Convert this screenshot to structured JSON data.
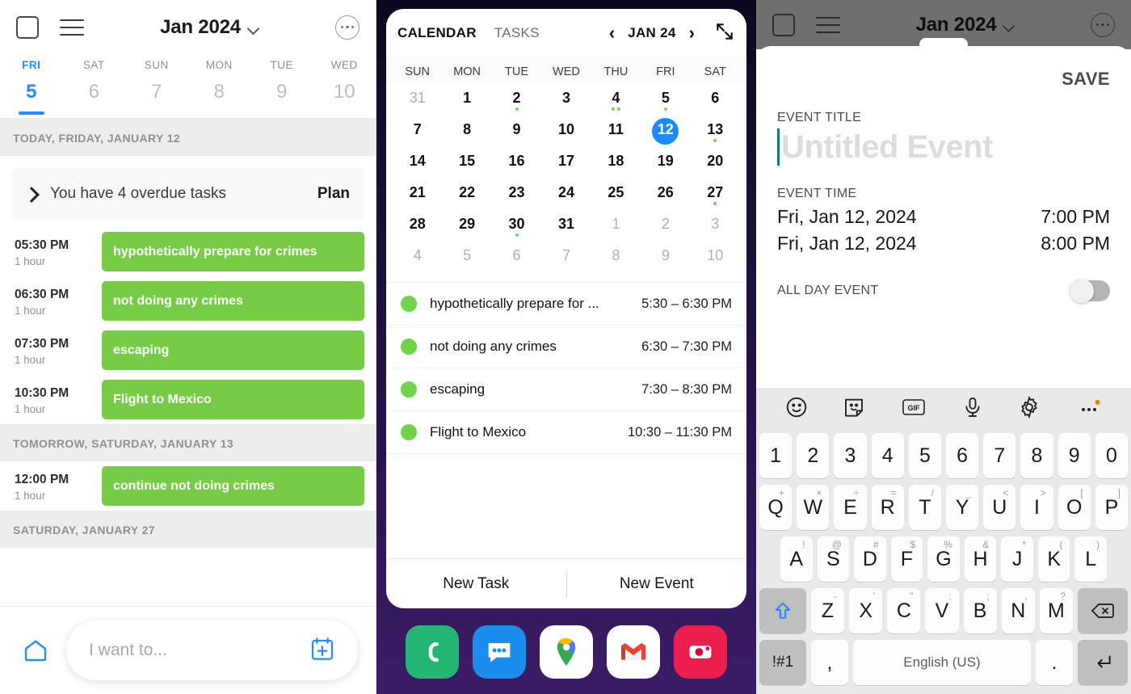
{
  "pane_tasks": {
    "topbar": {
      "checkbox_icon": "square-icon",
      "menu_icon": "hamburger-icon",
      "title": "Jan 2024",
      "chevron_icon": "chevron-down-icon",
      "more_icon": "more-options-icon"
    },
    "daystrip": [
      {
        "dow": "FRI",
        "num": "5",
        "active": true
      },
      {
        "dow": "SAT",
        "num": "6",
        "active": false
      },
      {
        "dow": "SUN",
        "num": "7",
        "active": false
      },
      {
        "dow": "MON",
        "num": "8",
        "active": false
      },
      {
        "dow": "TUE",
        "num": "9",
        "active": false
      },
      {
        "dow": "WED",
        "num": "10",
        "active": false
      }
    ],
    "section_today": "TODAY, FRIDAY, JANUARY 12",
    "overdue": {
      "expand_icon": "chevron-right-icon",
      "text": "You have 4 overdue tasks",
      "action": "Plan"
    },
    "today_tasks": [
      {
        "time": "05:30 PM",
        "dur": "1 hour",
        "title": "hypothetically prepare for crimes"
      },
      {
        "time": "06:30 PM",
        "dur": "1 hour",
        "title": "not doing any crimes"
      },
      {
        "time": "07:30 PM",
        "dur": "1 hour",
        "title": "escaping"
      },
      {
        "time": "10:30 PM",
        "dur": "1 hour",
        "title": "Flight to Mexico"
      }
    ],
    "section_tomorrow": "TOMORROW, SATURDAY, JANUARY 13",
    "tomorrow_tasks": [
      {
        "time": "12:00 PM",
        "dur": "1 hour",
        "title": "continue not doing crimes"
      }
    ],
    "section_sat27": "SATURDAY, JANUARY 27",
    "bottom": {
      "home_icon": "home-icon",
      "omni_placeholder": "I want to...",
      "add_event_icon": "calendar-plus-icon"
    },
    "colors": {
      "task_chip": "#76cc47",
      "accent": "#2c8aff",
      "section_bg": "#eceded"
    }
  },
  "pane_calendar": {
    "tabs": [
      {
        "label": "CALENDAR",
        "active": true
      },
      {
        "label": "TASKS",
        "active": false
      }
    ],
    "nav": {
      "prev_icon": "chevron-left-icon",
      "month": "JAN 24",
      "next_icon": "chevron-right-icon",
      "expand_icon": "expand-diagonal-icon"
    },
    "dow": [
      "SUN",
      "MON",
      "TUE",
      "WED",
      "THU",
      "FRI",
      "SAT"
    ],
    "weeks": [
      [
        {
          "n": "31",
          "muted": true,
          "dots": 0
        },
        {
          "n": "1",
          "muted": false,
          "dots": 0
        },
        {
          "n": "2",
          "muted": false,
          "dots": 1
        },
        {
          "n": "3",
          "muted": false,
          "dots": 0
        },
        {
          "n": "4",
          "muted": false,
          "dots": 2
        },
        {
          "n": "5",
          "muted": false,
          "dots": 1
        },
        {
          "n": "6",
          "muted": false,
          "dots": 0
        }
      ],
      [
        {
          "n": "7",
          "muted": false,
          "dots": 0
        },
        {
          "n": "8",
          "muted": false,
          "dots": 0
        },
        {
          "n": "9",
          "muted": false,
          "dots": 0
        },
        {
          "n": "10",
          "muted": false,
          "dots": 0
        },
        {
          "n": "11",
          "muted": false,
          "dots": 0
        },
        {
          "n": "12",
          "muted": false,
          "dots": 0,
          "selected": true
        },
        {
          "n": "13",
          "muted": false,
          "dots": 1
        }
      ],
      [
        {
          "n": "14",
          "muted": false,
          "dots": 0
        },
        {
          "n": "15",
          "muted": false,
          "dots": 0
        },
        {
          "n": "16",
          "muted": false,
          "dots": 0
        },
        {
          "n": "17",
          "muted": false,
          "dots": 0
        },
        {
          "n": "18",
          "muted": false,
          "dots": 0
        },
        {
          "n": "19",
          "muted": false,
          "dots": 0
        },
        {
          "n": "20",
          "muted": false,
          "dots": 0
        }
      ],
      [
        {
          "n": "21",
          "muted": false,
          "dots": 0
        },
        {
          "n": "22",
          "muted": false,
          "dots": 0
        },
        {
          "n": "23",
          "muted": false,
          "dots": 0
        },
        {
          "n": "24",
          "muted": false,
          "dots": 0
        },
        {
          "n": "25",
          "muted": false,
          "dots": 0
        },
        {
          "n": "26",
          "muted": false,
          "dots": 0
        },
        {
          "n": "27",
          "muted": false,
          "dots": 1
        }
      ],
      [
        {
          "n": "28",
          "muted": false,
          "dots": 0
        },
        {
          "n": "29",
          "muted": false,
          "dots": 0
        },
        {
          "n": "30",
          "muted": false,
          "dots": 1
        },
        {
          "n": "31",
          "muted": false,
          "dots": 0
        },
        {
          "n": "1",
          "muted": true,
          "dots": 0
        },
        {
          "n": "2",
          "muted": true,
          "dots": 0
        },
        {
          "n": "3",
          "muted": true,
          "dots": 0
        }
      ],
      [
        {
          "n": "4",
          "muted": true,
          "dots": 0
        },
        {
          "n": "5",
          "muted": true,
          "dots": 0
        },
        {
          "n": "6",
          "muted": true,
          "dots": 0
        },
        {
          "n": "7",
          "muted": true,
          "dots": 0
        },
        {
          "n": "8",
          "muted": true,
          "dots": 0
        },
        {
          "n": "9",
          "muted": true,
          "dots": 0
        },
        {
          "n": "10",
          "muted": true,
          "dots": 0
        }
      ]
    ],
    "events": [
      {
        "title": "hypothetically prepare for ...",
        "time": "5:30 – 6:30 PM"
      },
      {
        "title": "not doing any crimes",
        "time": "6:30 – 7:30 PM"
      },
      {
        "title": "escaping",
        "time": "7:30 – 8:30 PM"
      },
      {
        "title": "Flight to Mexico",
        "time": "10:30 – 11:30 PM"
      }
    ],
    "footer": {
      "new_task": "New Task",
      "new_event": "New Event"
    },
    "dock": [
      {
        "name": "phone-app-icon",
        "color": "#22b573"
      },
      {
        "name": "messages-app-icon",
        "color": "#1d8ded"
      },
      {
        "name": "maps-app-icon",
        "color": "#ffffff"
      },
      {
        "name": "gmail-app-icon",
        "color": "#ffffff"
      },
      {
        "name": "camera-app-icon",
        "color": "#ec1e4e"
      }
    ],
    "colors": {
      "selected_day": "#1a8cff",
      "event_dot": "#6fd44a",
      "wallpaper_top": "#0b0820",
      "wallpaper_bottom": "#3b1d66"
    }
  },
  "pane_editor": {
    "dimmed_topbar": {
      "checkbox_icon": "square-icon",
      "menu_icon": "hamburger-icon",
      "title": "Jan 2024",
      "chevron_icon": "chevron-down-icon",
      "more_icon": "more-options-icon"
    },
    "save_label": "SAVE",
    "title_label": "EVENT TITLE",
    "title_placeholder": "Untitled Event",
    "title_value": "",
    "time_label": "EVENT TIME",
    "start": {
      "date": "Fri, Jan 12, 2024",
      "time": "7:00 PM"
    },
    "end": {
      "date": "Fri, Jan 12, 2024",
      "time": "8:00 PM"
    },
    "all_day_label": "ALL DAY EVENT",
    "all_day_on": false,
    "colors": {
      "caret": "#127e72",
      "placeholder": "#dcdcdc"
    },
    "keyboard": {
      "toolbar": [
        "emoji-icon",
        "sticker-icon",
        "gif-icon",
        "microphone-icon",
        "settings-icon",
        "more-icon"
      ],
      "row1": [
        {
          "k": "1"
        },
        {
          "k": "2"
        },
        {
          "k": "3"
        },
        {
          "k": "4"
        },
        {
          "k": "5"
        },
        {
          "k": "6"
        },
        {
          "k": "7"
        },
        {
          "k": "8"
        },
        {
          "k": "9"
        },
        {
          "k": "0"
        }
      ],
      "row2": [
        {
          "k": "Q",
          "s": "+"
        },
        {
          "k": "W",
          "s": "×"
        },
        {
          "k": "E",
          "s": "÷"
        },
        {
          "k": "R",
          "s": "="
        },
        {
          "k": "T",
          "s": "/"
        },
        {
          "k": "Y",
          "s": "_"
        },
        {
          "k": "U",
          "s": "<"
        },
        {
          "k": "I",
          "s": ">"
        },
        {
          "k": "O",
          "s": "["
        },
        {
          "k": "P",
          "s": "]"
        }
      ],
      "row3": [
        {
          "k": "A",
          "s": "!"
        },
        {
          "k": "S",
          "s": "@"
        },
        {
          "k": "D",
          "s": "#"
        },
        {
          "k": "F",
          "s": "$"
        },
        {
          "k": "G",
          "s": "%"
        },
        {
          "k": "H",
          "s": "&"
        },
        {
          "k": "J",
          "s": "*"
        },
        {
          "k": "K",
          "s": "("
        },
        {
          "k": "L",
          "s": ")"
        }
      ],
      "row4": [
        {
          "k": "Z",
          "s": "-"
        },
        {
          "k": "X",
          "s": "'"
        },
        {
          "k": "C",
          "s": "\""
        },
        {
          "k": "V",
          "s": ":"
        },
        {
          "k": "B",
          "s": ";"
        },
        {
          "k": "N",
          "s": ","
        },
        {
          "k": "M",
          "s": "?"
        }
      ],
      "shift_icon": "shift-up-icon",
      "backspace_icon": "backspace-icon",
      "symbols_key": "!#1",
      "comma_key": ",",
      "space_key": "English (US)",
      "period_key": ".",
      "enter_icon": "enter-return-icon"
    }
  }
}
